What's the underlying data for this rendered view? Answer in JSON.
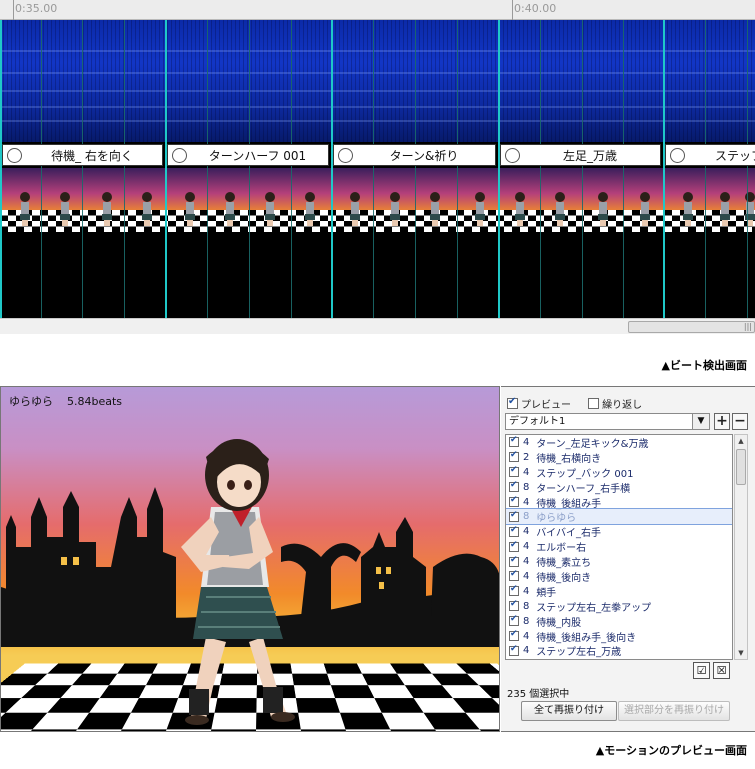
{
  "timeline": {
    "ticks": [
      {
        "label": "0:35.00"
      },
      {
        "label": "0:40.00"
      }
    ],
    "segments": [
      {
        "label": "待機_ 右を向く"
      },
      {
        "label": "ターンハーフ 001"
      },
      {
        "label": "ターン&祈り"
      },
      {
        "label": "左足_万歳"
      },
      {
        "label": "ステップ左"
      }
    ]
  },
  "captions": {
    "beat_screen": "▲ビート検出画面",
    "preview_screen": "▲モーションのプレビュー画面"
  },
  "preview": {
    "motion_name": "ゆらゆら",
    "beats": "5.84beats"
  },
  "panel": {
    "preview_option": {
      "label": "プレビュー",
      "checked": true
    },
    "loop_option": {
      "label": "繰り返し",
      "checked": false
    },
    "preset": {
      "value": "デフォルト1",
      "arrow": "▼"
    },
    "add_label": "+",
    "remove_label": "−",
    "motions": [
      {
        "count": "4",
        "name": "ターン_左足キック&万歳",
        "checked": true
      },
      {
        "count": "2",
        "name": "待機_右横向き",
        "checked": true
      },
      {
        "count": "4",
        "name": "ステップ_バック 001",
        "checked": true
      },
      {
        "count": "8",
        "name": "ターンハーフ_右手横",
        "checked": true
      },
      {
        "count": "4",
        "name": "待機_後組み手",
        "checked": true
      },
      {
        "count": "8",
        "name": "ゆらゆら",
        "checked": true,
        "selected": true
      },
      {
        "count": "4",
        "name": "バイバイ_右手",
        "checked": true
      },
      {
        "count": "4",
        "name": "エルボー右",
        "checked": true
      },
      {
        "count": "4",
        "name": "待機_素立ち",
        "checked": true
      },
      {
        "count": "4",
        "name": "待機_後向き",
        "checked": true
      },
      {
        "count": "4",
        "name": "頬手",
        "checked": true
      },
      {
        "count": "8",
        "name": "ステップ左右_左拳アップ",
        "checked": true
      },
      {
        "count": "8",
        "name": "待機_内股",
        "checked": true
      },
      {
        "count": "4",
        "name": "待機_後組み手_後向き",
        "checked": true
      },
      {
        "count": "4",
        "name": "ステップ左右_万歳",
        "checked": true
      }
    ],
    "check_all_icon": "☑",
    "uncheck_all_icon": "☒",
    "selection_count": "235 個選択中",
    "reassign_all_label": "全て再振り付け",
    "reassign_selected_label": "選択部分を再振り付け"
  }
}
